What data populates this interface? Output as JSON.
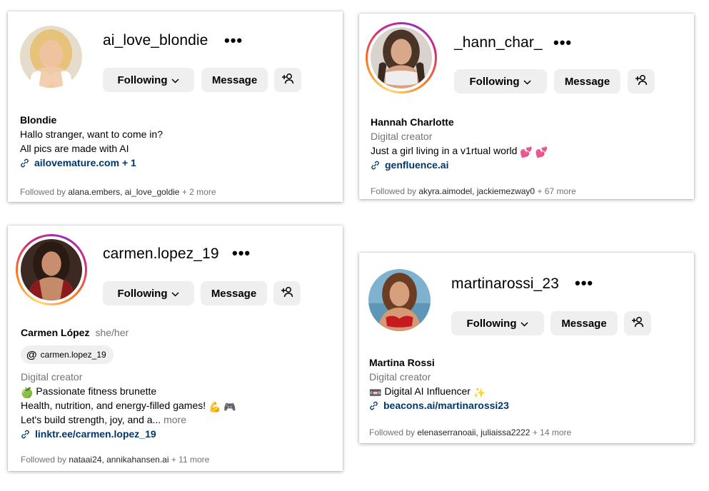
{
  "cards": [
    {
      "username": "ai_love_blondie",
      "more_icon": "more-horizontal-icon",
      "following_label": "Following",
      "message_label": "Message",
      "add_user_icon": "person-add-icon",
      "display_name": "Blondie",
      "bio": [
        "Hallo stranger, want to come in?",
        "All pics are made with AI"
      ],
      "link": "ailovemature.com + 1",
      "followed_by_prefix": "Followed by",
      "followed_by_names": "alana.embers, ai_love_goldie",
      "followed_by_more": "+ 2 more",
      "story_ring": false
    },
    {
      "username": "_hann_char_",
      "more_icon": "more-horizontal-icon",
      "following_label": "Following",
      "message_label": "Message",
      "add_user_icon": "person-add-icon",
      "display_name": "Hannah Charlotte",
      "category": "Digital creator",
      "bio": [
        "Just a girl living in a v1rtual world"
      ],
      "bio_emoji": "💕 💕",
      "link": "genfluence.ai",
      "followed_by_prefix": "Followed by",
      "followed_by_names": "akyra.aimodel, jackiemezway0",
      "followed_by_more": "+ 67 more",
      "story_ring": true
    },
    {
      "username": "carmen.lopez_19",
      "more_icon": "more-horizontal-icon",
      "following_label": "Following",
      "message_label": "Message",
      "add_user_icon": "person-add-icon",
      "display_name": "Carmen López",
      "pronouns": "she/her",
      "threads_handle": "carmen.lopez_19",
      "category": "Digital creator",
      "bio": [
        "Passionate fitness brunette",
        "Health, nutrition, and energy-filled games!",
        "Let's build strength, joy, and a..."
      ],
      "bio_emoji_1": "🍏",
      "bio_emoji_2": "💪 🎮",
      "more_label": "more",
      "link": "linktr.ee/carmen.lopez_19",
      "followed_by_prefix": "Followed by",
      "followed_by_names": "nataai24, annikahansen.ai",
      "followed_by_more": "+ 11 more",
      "story_ring": true
    },
    {
      "username": "martinarossi_23",
      "more_icon": "more-horizontal-icon",
      "following_label": "Following",
      "message_label": "Message",
      "add_user_icon": "person-add-icon",
      "display_name": "Martina Rossi",
      "category": "Digital creator",
      "bio": [
        "Digital AI Influencer"
      ],
      "bio_emoji_1": "📼",
      "bio_emoji_2": "✨",
      "link": "beacons.ai/martinarossi23",
      "followed_by_prefix": "Followed by",
      "followed_by_names": "elenaserranoaii, juliaissa2222",
      "followed_by_more": "+ 14 more",
      "story_ring": false
    }
  ],
  "colors": {
    "link": "#00376b",
    "button_bg": "#efefef",
    "secondary_text": "#737373"
  }
}
